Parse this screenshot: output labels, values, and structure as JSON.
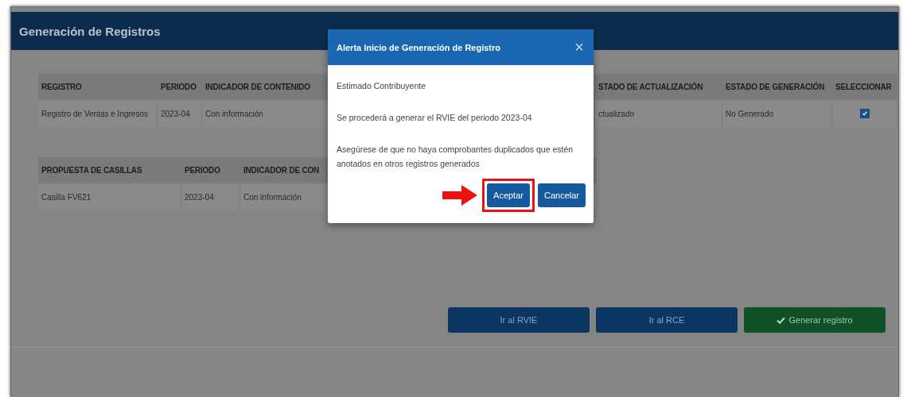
{
  "panel": {
    "title": "Generación de Registros"
  },
  "registros_table": {
    "columns": [
      "REGISTRO",
      "PERIODO",
      "INDICADOR DE CONTENIDO",
      "",
      "STADO DE ACTUALIZACIÓN",
      "ESTADO DE GENERACIÓN",
      "SELECCIONAR"
    ],
    "rows": [
      {
        "cells": [
          "Registro de Ventas e Ingresos",
          "2023-04",
          "Con información",
          "",
          "ctualizado",
          "No Generado"
        ],
        "checked": true
      }
    ]
  },
  "casillas_table": {
    "columns": [
      "PROPUESTA DE CASILLAS",
      "PERIODO",
      "INDICADOR DE CON"
    ],
    "rows": [
      {
        "cells": [
          "Casilla FV621",
          "2023-04",
          "Con información"
        ]
      }
    ]
  },
  "actions": [
    {
      "label": "Ir al RVIE",
      "kind": "primary"
    },
    {
      "label": "Ir al RCE",
      "kind": "primary"
    },
    {
      "label": "Generar registro",
      "kind": "success"
    }
  ],
  "dialog": {
    "title": "Alerta Inicio de Generación de Registro",
    "close": "×",
    "paragraphs": [
      "Estimado Contribuyente",
      "Se procederá a generar el RVIE del periodo 2023-04",
      "Asegúrese de que no haya comprobantes duplicados que estén anotados en otros registros generados"
    ],
    "buttons": [
      {
        "label": "Aceptar",
        "highlighted": true
      },
      {
        "label": "Cancelar",
        "highlighted": false
      }
    ]
  }
}
